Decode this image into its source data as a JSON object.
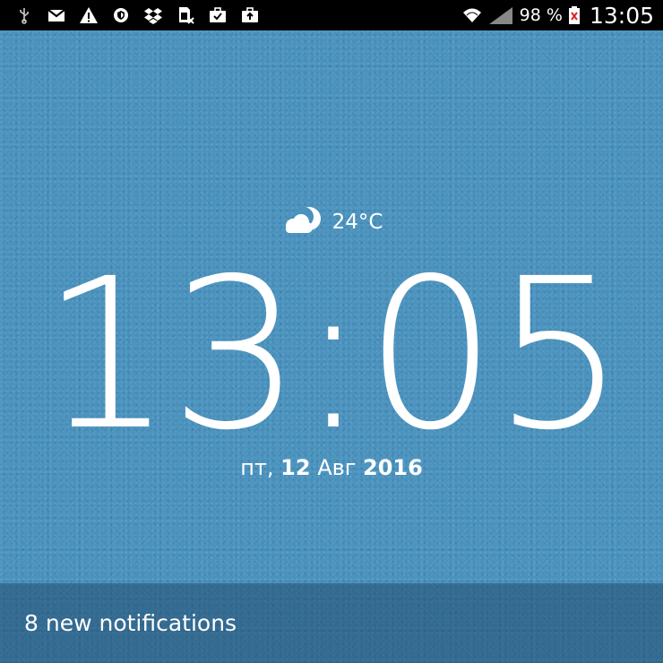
{
  "status_bar": {
    "left_icons": [
      "usb-icon",
      "gmail-icon",
      "warning-icon",
      "shield-icon",
      "dropbox-icon",
      "sim-error-icon",
      "clipboard-check-icon",
      "briefcase-upload-icon"
    ],
    "battery_percent": "98 %",
    "time": "13:05"
  },
  "lockscreen": {
    "weather_icon": "partly-cloudy-night-icon",
    "temperature": "24°C",
    "time": "13:05",
    "date": {
      "weekday": "пт,",
      "day": "12",
      "month": "Авг",
      "year": "2016"
    }
  },
  "notifications": {
    "label": "8 new notifications"
  },
  "colors": {
    "background": "#4a93bf",
    "status_bar": "#000000",
    "notification_bar": "#2a5473"
  }
}
